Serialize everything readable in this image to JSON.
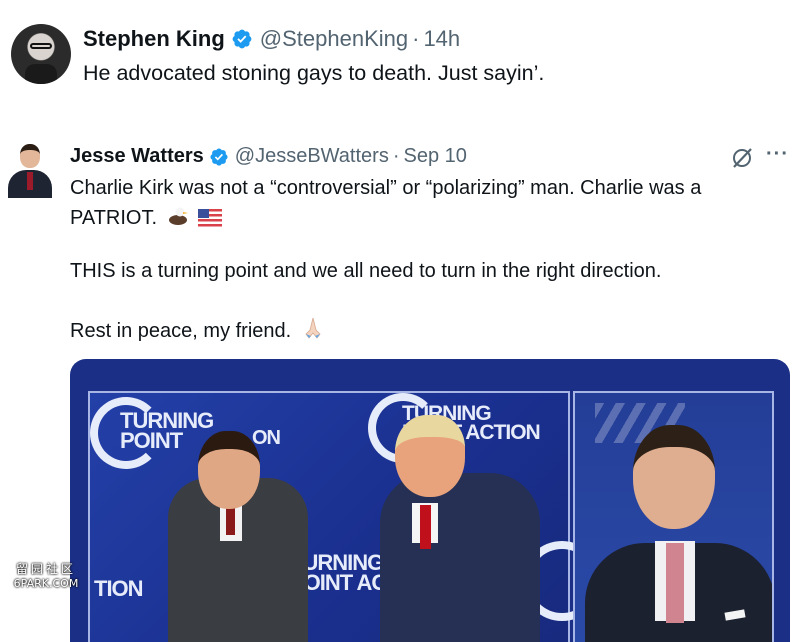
{
  "tweets": [
    {
      "author_name": "Stephen King",
      "handle": "@StephenKing",
      "separator": "·",
      "time": "14h",
      "text": "He advocated stoning gays to death. Just sayin’."
    },
    {
      "author_name": "Jesse Watters",
      "handle": "@JesseBWatters",
      "separator": "·",
      "time": "Sep 10",
      "lines": [
        "Charlie Kirk was not a “controversial” or “polarizing” man. Charlie was a",
        "PATRIOT.",
        "THIS is a turning point and we all need to turn in the right direction.",
        "Rest in peace, my friend."
      ],
      "emojis": [
        "eagle",
        "us-flag",
        "folded-hands"
      ],
      "more_label": "···",
      "media": {
        "signage": [
          "TURNING",
          "POINT",
          "ON",
          "TURNING",
          "POINT ACTION",
          "TURNING",
          "POINT AC",
          "TION"
        ]
      }
    }
  ],
  "watermark": {
    "top": "留园社区",
    "bottom": "6PARK.COM"
  },
  "colors": {
    "verified": "#1d9bf0",
    "secondary_text": "#536471",
    "media_bg": "#1b2f86"
  }
}
